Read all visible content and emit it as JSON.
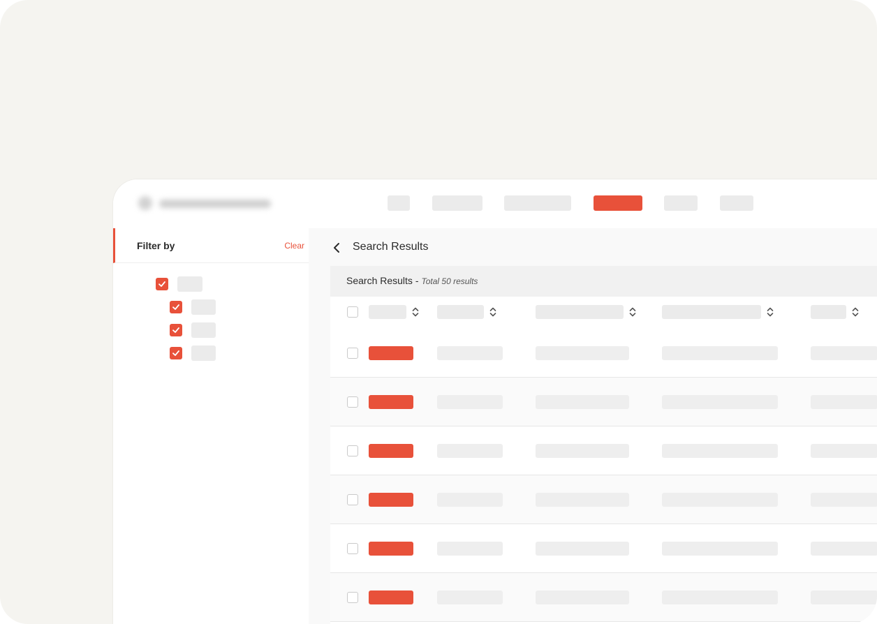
{
  "colors": {
    "accent": "#e8513a",
    "background": "#f5f4f0",
    "placeholder": "#ebebeb"
  },
  "icons": {
    "back": "chevron-left-icon",
    "sort": "sort-updown-icon",
    "check": "check-icon"
  },
  "sidebar": {
    "title": "Filter by",
    "clear_label": "Clear"
  },
  "main": {
    "page_title": "Search Results",
    "results_title": "Search Results -",
    "results_count": "Total 50 results"
  }
}
